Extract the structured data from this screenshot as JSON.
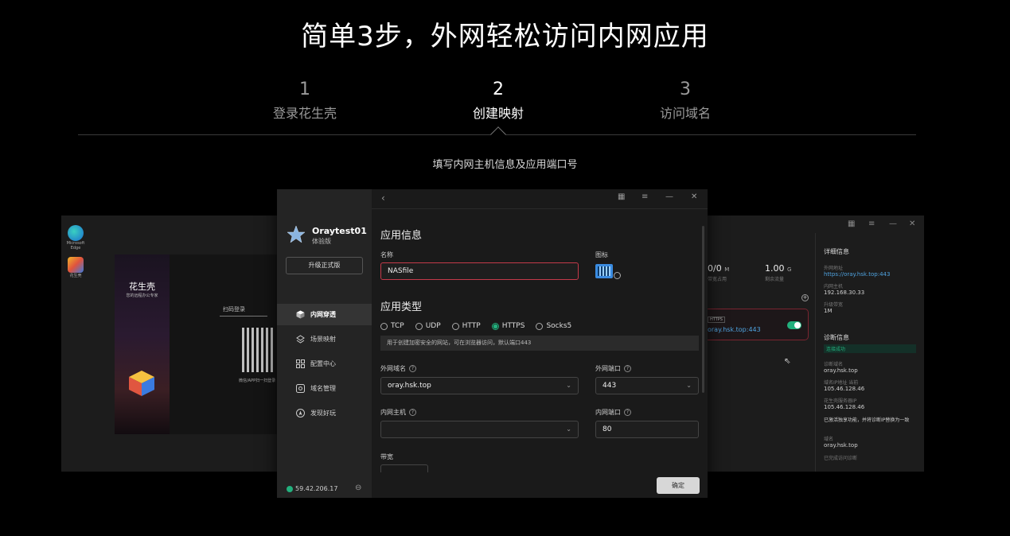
{
  "hero": {
    "title": "简单3步，外网轻松访问内网应用"
  },
  "steps": [
    {
      "num": "1",
      "label": "登录花生壳"
    },
    {
      "num": "2",
      "label": "创建映射"
    },
    {
      "num": "3",
      "label": "访问域名"
    }
  ],
  "subtitle": "填写内网主机信息及应用端口号",
  "bg_left": {
    "desktop_icons": [
      {
        "caption": "Microsoft Edge"
      },
      {
        "caption": "花生壳"
      }
    ],
    "brand": "花生壳",
    "brand_tagline": "您的远程办公专家",
    "scan_label": "扫码登录",
    "qr_caption": "微信/APP扫一扫登录"
  },
  "bg_right": {
    "stats": [
      {
        "value": "0/0",
        "unit": "M",
        "label": "带宽占用"
      },
      {
        "value": "1.00",
        "unit": "G",
        "label": "剩余流量"
      }
    ],
    "map_badge": "HTTPS",
    "map_domain": "oray.hsk.top:443",
    "detail": {
      "title": "详细信息",
      "ext_label": "外网地址",
      "ext_value": "https://oray.hsk.top:443",
      "int_label": "内网主机",
      "int_value": "192.168.30.33",
      "bw_label": "升级带宽",
      "bw_value": "1M",
      "diag_title": "诊断信息",
      "diag_status": "连接成功",
      "diag_domain_label": "诊断域名",
      "diag_domain": "oray.hsk.top",
      "resolve_label": "域名IP地址 当前",
      "resolve_value": "105.46.128.46",
      "server_label": "花生壳服务器IP",
      "server_value": "105.46.128.46",
      "note": "已激活独享功能，并将诊断IP替换为一致",
      "last_label": "域名",
      "last_value": "oray.hsk.top",
      "last_note": "已完成访问诊断"
    }
  },
  "window": {
    "user": {
      "name": "Oraytest01",
      "plan": "体验版"
    },
    "upgrade_label": "升级正式版",
    "nav": [
      {
        "label": "内网穿透",
        "icon": "cube-icon"
      },
      {
        "label": "场景映射",
        "icon": "layers-icon"
      },
      {
        "label": "配置中心",
        "icon": "grid-icon"
      },
      {
        "label": "域名管理",
        "icon": "domain-icon"
      },
      {
        "label": "发现好玩",
        "icon": "compass-icon"
      }
    ],
    "ip": "59.42.206.17",
    "form": {
      "section_info": "应用信息",
      "name_label": "名称",
      "name_value": "NASfile",
      "icon_label": "图标",
      "section_type": "应用类型",
      "types": [
        "TCP",
        "UDP",
        "HTTP",
        "HTTPS",
        "Socks5"
      ],
      "selected_type": "HTTPS",
      "type_hint": "用于创建加密安全的网站，可在浏览器访问，默认端口443",
      "ext_domain_label": "外网域名",
      "ext_domain_value": "oray.hsk.top",
      "ext_port_label": "外网端口",
      "ext_port_value": "443",
      "int_host_label": "内网主机",
      "int_host_value": "",
      "int_port_label": "内网端口",
      "int_port_value": "80",
      "bandwidth_label": "带宽",
      "confirm_label": "确定"
    }
  },
  "colors": {
    "accent": "#22b07d",
    "error_border": "#c43a4a",
    "link": "#4fa3e0"
  }
}
